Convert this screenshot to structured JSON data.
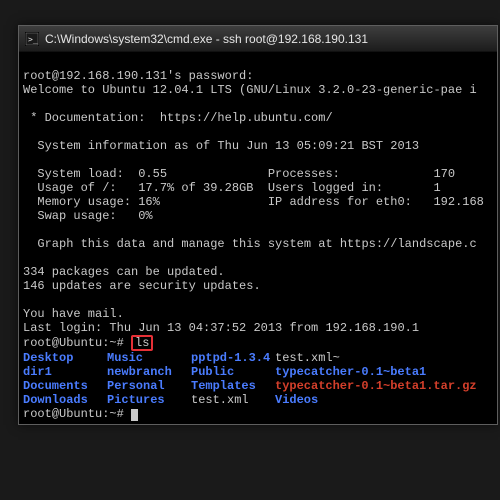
{
  "window": {
    "title": "C:\\Windows\\system32\\cmd.exe - ssh  root@192.168.190.131"
  },
  "term": {
    "pwline": "root@192.168.190.131's password:",
    "welcome": "Welcome to Ubuntu 12.04.1 LTS (GNU/Linux 3.2.0-23-generic-pae i",
    "blank": "",
    "doc": " * Documentation:  https://help.ubuntu.com/",
    "sysinfo_hdr": "  System information as of Thu Jun 13 05:09:21 BST 2013",
    "sys1": "  System load:  0.55              Processes:             170",
    "sys2": "  Usage of /:   17.7% of 39.28GB  Users logged in:       1",
    "sys3": "  Memory usage: 16%               IP address for eth0:   192.168",
    "sys4": "  Swap usage:   0%",
    "graph": "  Graph this data and manage this system at https://landscape.c",
    "pkg1": "334 packages can be updated.",
    "pkg2": "146 updates are security updates.",
    "mail": "You have mail.",
    "lastlogin": "Last login: Thu Jun 13 04:37:52 2013 from 192.168.190.1",
    "prompt1_prefix": "root@Ubuntu:~# ",
    "ls_cmd": "ls",
    "ls": {
      "r1c1": "Desktop",
      "r1c2": "Music",
      "r1c3": "pptpd-1.3.4",
      "r1c4": "test.xml~",
      "r2c1": "dir1",
      "r2c2": "newbranch",
      "r2c3": "Public",
      "r2c4": "typecatcher-0.1~beta1",
      "r3c1": "Documents",
      "r3c2": "Personal",
      "r3c3": "Templates",
      "r3c4": "typecatcher-0.1~beta1.tar.gz",
      "r4c1": "Downloads",
      "r4c2": "Pictures",
      "r4c3": "test.xml",
      "r4c4": "Videos"
    },
    "prompt2": "root@Ubuntu:~# "
  }
}
